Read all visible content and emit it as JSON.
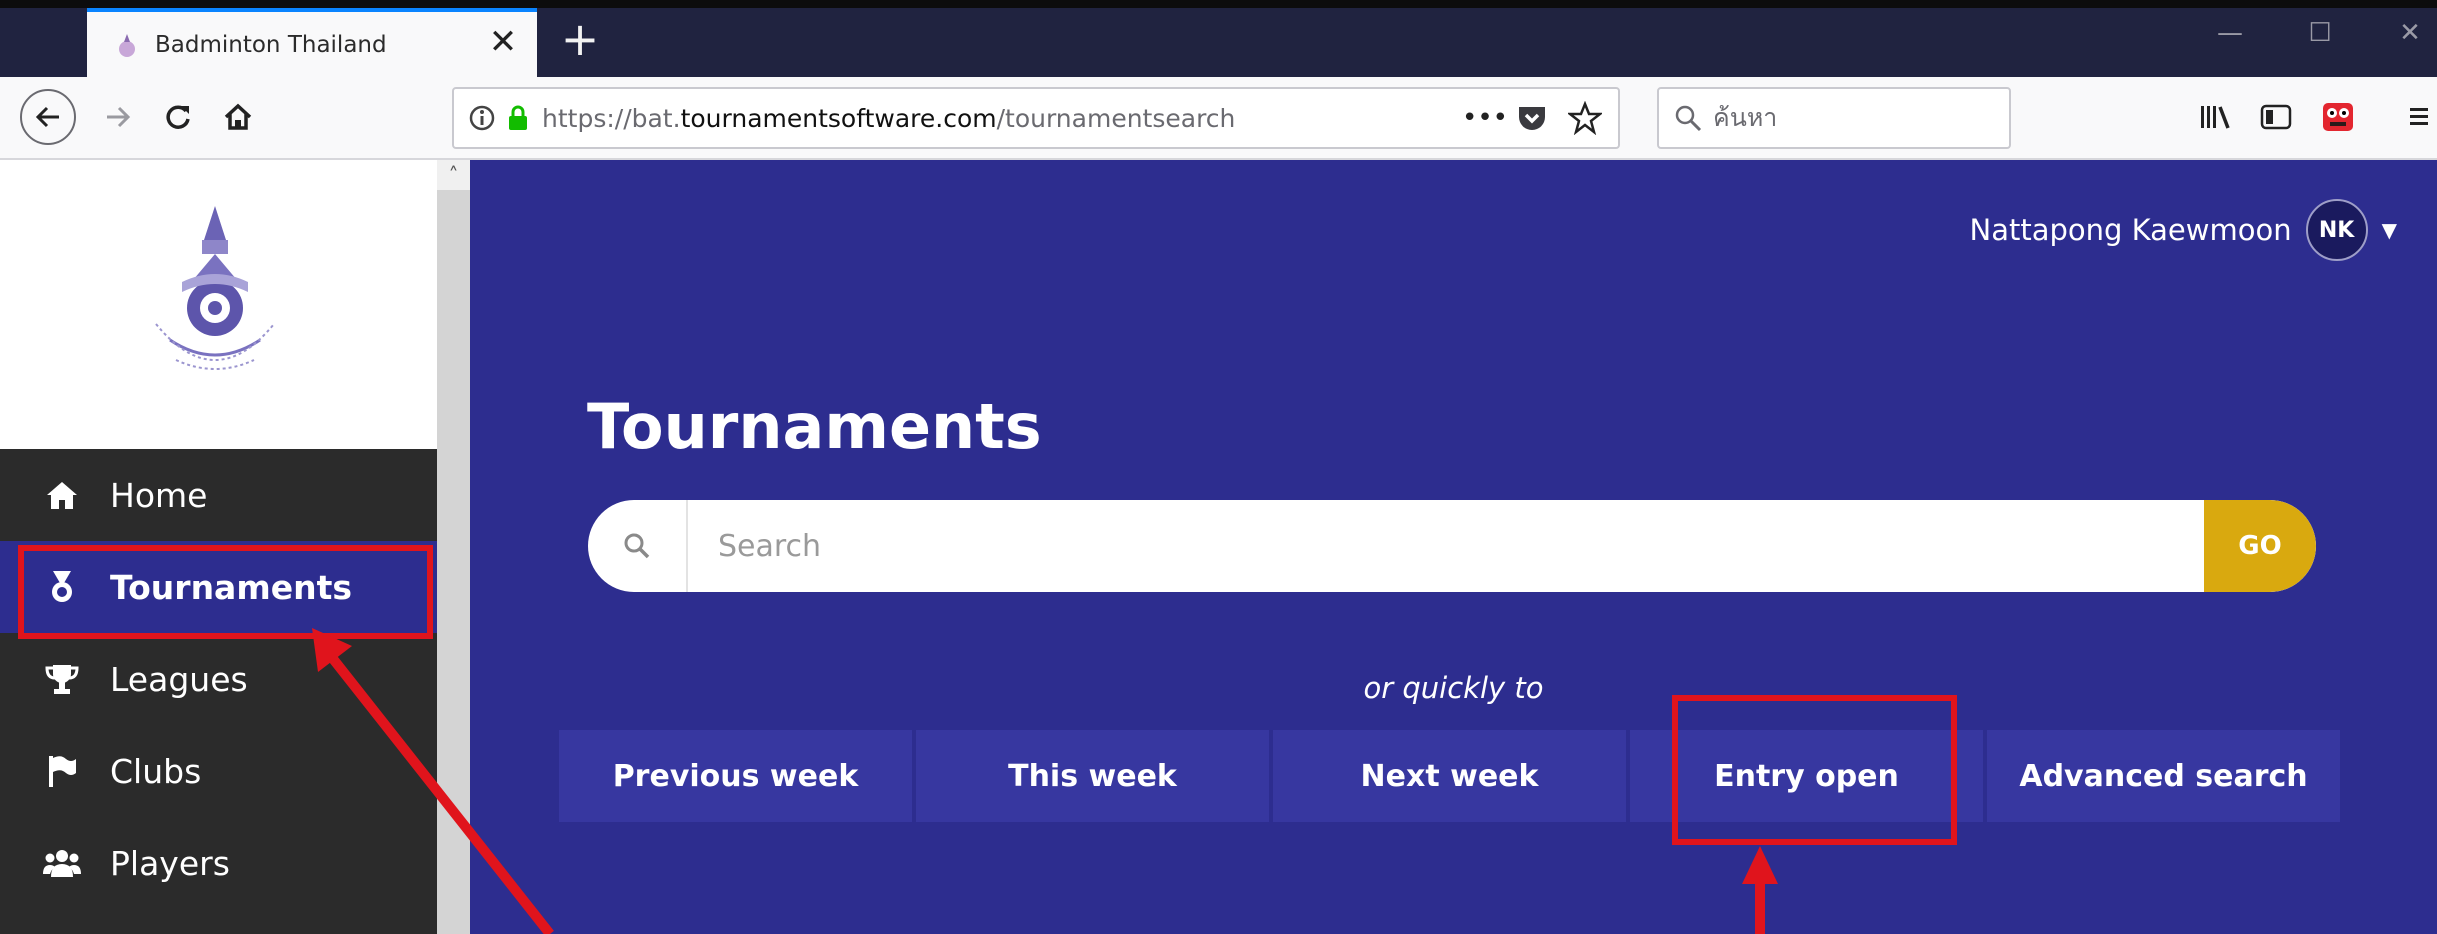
{
  "browser": {
    "tab_title": "Badminton Thailand",
    "url_prefix": "https://bat.",
    "url_domain": "tournamentsoftware.com",
    "url_path": "/tournamentsearch",
    "url_menu": "•••",
    "search_placeholder": "ค้นหา"
  },
  "site": {
    "user_name": "Nattapong Kaewmoon",
    "user_initials": "NK"
  },
  "sidebar": {
    "items": [
      {
        "label": "Home",
        "icon": "home-icon"
      },
      {
        "label": "Tournaments",
        "icon": "medal-icon",
        "active": true
      },
      {
        "label": "Leagues",
        "icon": "trophy-icon"
      },
      {
        "label": "Clubs",
        "icon": "flag-icon"
      },
      {
        "label": "Players",
        "icon": "users-icon"
      }
    ]
  },
  "main": {
    "title": "Tournaments",
    "search_placeholder": "Search",
    "go_label": "GO",
    "quick_label": "or quickly to",
    "quick_links": [
      "Previous week",
      "This week",
      "Next week",
      "Entry open",
      "Advanced search"
    ]
  },
  "colors": {
    "main_bg": "#2d2d8f",
    "sidebar_bg": "#2b2b2b",
    "go_button": "#d9a90f",
    "annotation_red": "#e0141c",
    "tab_accent": "#0a84ff"
  }
}
